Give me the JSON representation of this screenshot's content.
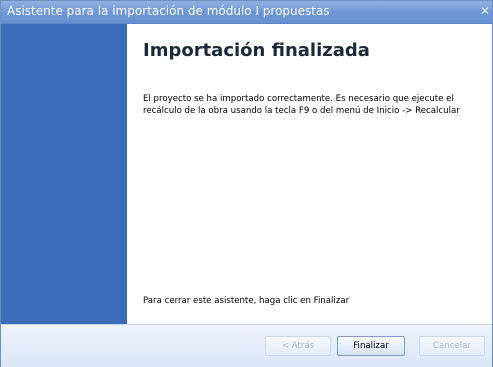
{
  "window": {
    "title": "Asistente para la importación de módulo I propuestas",
    "close_glyph": "✕"
  },
  "content": {
    "heading": "Importación finalizada",
    "message": "El proyecto se ha importado correctamente. Es necesario que ejecute el recálculo de la obra usando la tecla F9 o del menú de Inicio -> Recalcular",
    "footer_note": "Para cerrar este asistente, haga clic en Finalizar"
  },
  "buttons": {
    "back": "< Atrás",
    "finish": "Finalizar",
    "cancel": "Cancelar"
  },
  "colors": {
    "sidebar": "#3c6bb8",
    "titlebar": "#6f97d6"
  }
}
